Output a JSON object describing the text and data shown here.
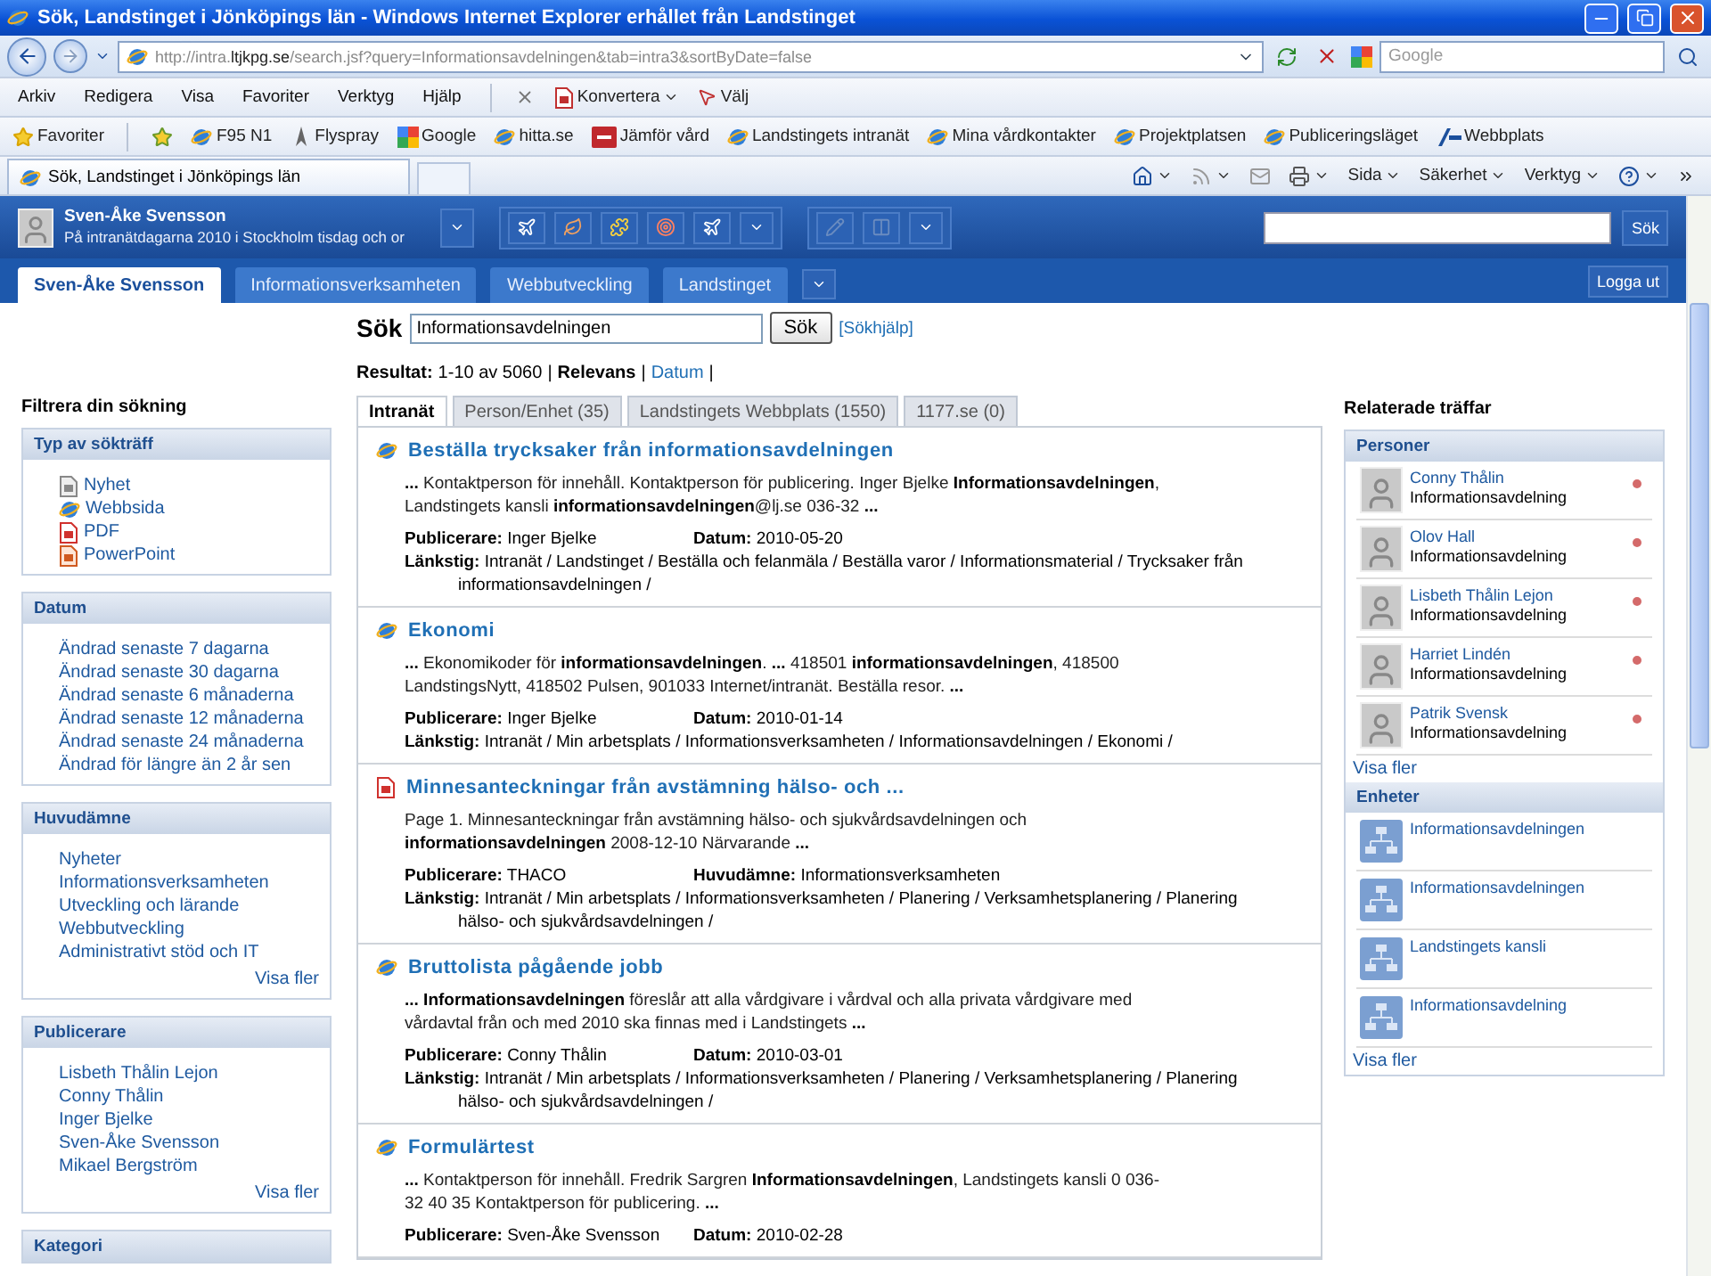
{
  "window": {
    "title": "Sök, Landstinget i Jönköpings län - Windows Internet Explorer erhållet från Landstinget"
  },
  "address_bar": {
    "url": "http://intra.**ltjkpg.se**/search.jsf?query=Informationsavdelningen&tab=intra3&sortByDate=false",
    "search_placeholder": "Google"
  },
  "menu": [
    "Arkiv",
    "Redigera",
    "Visa",
    "Favoriter",
    "Verktyg",
    "Hjälp"
  ],
  "toolbar_buttons": [
    {
      "label": "Konvertera",
      "kind": "convert"
    },
    {
      "label": "Välj",
      "kind": "select"
    }
  ],
  "favorites_bar": {
    "label": "Favoriter",
    "links": [
      {
        "label": "F95 N1",
        "kind": "ie"
      },
      {
        "label": "Flyspray",
        "kind": "flyspray"
      },
      {
        "label": "Google",
        "kind": "google"
      },
      {
        "label": "hitta.se",
        "kind": "ie"
      },
      {
        "label": "Jämför vård",
        "kind": "badge"
      },
      {
        "label": "Landstingets intranät",
        "kind": "ie"
      },
      {
        "label": "Mina vårdkontakter",
        "kind": "ie"
      },
      {
        "label": "Projektplatsen",
        "kind": "ie"
      },
      {
        "label": "Publiceringsläget",
        "kind": "ie"
      },
      {
        "label": "Webbplats",
        "kind": "logo"
      }
    ]
  },
  "browser_tab": {
    "title": "Sök, Landstinget i Jönköpings län"
  },
  "command_bar": [
    "Sida",
    "Säkerhet",
    "Verktyg"
  ],
  "user": {
    "name": "Sven-Åke Svensson",
    "status": "På intranätdagarna 2010 i Stockholm tisdag och or"
  },
  "header_search": {
    "button": "Sök"
  },
  "nav_tabs": [
    {
      "label": "Sven-Åke Svensson",
      "selected": true
    },
    {
      "label": "Informationsverksamheten",
      "selected": false
    },
    {
      "label": "Webbutveckling",
      "selected": false
    },
    {
      "label": "Landstinget",
      "selected": false
    }
  ],
  "logout": "Logga ut",
  "filters": {
    "title": "Filtrera din sökning",
    "groups": [
      {
        "title": "Typ av sökträff",
        "items": [
          {
            "label": "Nyhet",
            "kind": "news"
          },
          {
            "label": "Webbsida",
            "kind": "web"
          },
          {
            "label": "PDF",
            "kind": "pdf"
          },
          {
            "label": "PowerPoint",
            "kind": "ppt"
          }
        ]
      },
      {
        "title": "Datum",
        "items": [
          {
            "label": "Ändrad senaste 7 dagarna"
          },
          {
            "label": "Ändrad senaste 30 dagarna"
          },
          {
            "label": "Ändrad senaste 6 månaderna"
          },
          {
            "label": "Ändrad senaste 12 månaderna"
          },
          {
            "label": "Ändrad senaste 24 månaderna"
          },
          {
            "label": "Ändrad för längre än 2 år sen"
          }
        ]
      },
      {
        "title": "Huvudämne",
        "items": [
          {
            "label": "Nyheter"
          },
          {
            "label": "Informationsverksamheten"
          },
          {
            "label": "Utveckling och lärande"
          },
          {
            "label": "Webbutveckling"
          },
          {
            "label": "Administrativt stöd och IT"
          }
        ],
        "more": "Visa fler"
      },
      {
        "title": "Publicerare",
        "items": [
          {
            "label": "Lisbeth Thålin Lejon"
          },
          {
            "label": "Conny Thålin"
          },
          {
            "label": "Inger Bjelke"
          },
          {
            "label": "Sven-Åke Svensson"
          },
          {
            "label": "Mikael Bergström"
          }
        ],
        "more": "Visa fler"
      },
      {
        "title": "Kategori"
      }
    ]
  },
  "search": {
    "heading": "Sök",
    "value": "Informationsavdelningen",
    "button": "Sök",
    "help": "[Sökhjälp]"
  },
  "results_summary": {
    "label": "Resultat:",
    "range": "1-10 av 5060",
    "separator": "|",
    "sort_options": [
      {
        "label": "Relevans",
        "selected": true
      },
      {
        "label": "Datum",
        "selected": false
      }
    ]
  },
  "result_tabs": [
    {
      "label": "Intranät",
      "selected": true
    },
    {
      "label": "Person/Enhet (35)",
      "selected": false
    },
    {
      "label": "Landstingets Webbplats (1550)",
      "selected": false
    },
    {
      "label": "1177.se (0)",
      "selected": false
    }
  ],
  "results": [
    {
      "kind": "web",
      "title": "Beställa trycksaker från informationsavdelningen",
      "snippet": "**...** Kontaktperson för innehåll. Kontaktperson för publicering. Inger Bjelke **Informationsavdelningen**, Landstingets kansli **informationsavdelningen**@lj.se 036-32 **...**",
      "meta": [
        {
          "label": "Publicerare:",
          "value": "Inger Bjelke"
        },
        {
          "label": "Datum:",
          "value": "2010-05-20"
        }
      ],
      "path": {
        "label": "Länkstig:",
        "value": "Intranät / Landstinget / Beställa och felanmäla / Beställa varor / Informationsmaterial / Trycksaker från informationsavdelningen /"
      }
    },
    {
      "kind": "web",
      "title": "Ekonomi",
      "snippet": "**...** Ekonomikoder för **informationsavdelningen**. **...** 418501 **informationsavdelningen**, 418500 LandstingsNytt, 418502 Pulsen, 901033 Internet/intranät. Beställa resor. **...**",
      "meta": [
        {
          "label": "Publicerare:",
          "value": "Inger Bjelke"
        },
        {
          "label": "Datum:",
          "value": "2010-01-14"
        }
      ],
      "path": {
        "label": "Länkstig:",
        "value": "Intranät / Min arbetsplats / Informationsverksamheten / Informationsavdelningen / Ekonomi /"
      }
    },
    {
      "kind": "pdf",
      "title": "Minnesanteckningar från avstämning hälso- och ...",
      "snippet": "Page 1. Minnesanteckningar från avstämning hälso- och sjukvårdsavdelningen och **informationsavdelningen** 2008-12-10 Närvarande **...**",
      "meta": [
        {
          "label": "Publicerare:",
          "value": "THACO"
        },
        {
          "label": "Huvudämne:",
          "value": "Informationsverksamheten"
        }
      ],
      "path": {
        "label": "Länkstig:",
        "value": "Intranät / Min arbetsplats / Informationsverksamheten / Planering / Verksamhetsplanering / Planering hälso- och sjukvårdsavdelningen /"
      }
    },
    {
      "kind": "web",
      "title": "Bruttolista pågående jobb",
      "snippet": "**... Informationsavdelningen** föreslår att alla vårdgivare i vårdval och alla privata vårdgivare med vårdavtal från och med 2010 ska finnas med i Landstingets **...**",
      "meta": [
        {
          "label": "Publicerare:",
          "value": "Conny Thålin"
        },
        {
          "label": "Datum:",
          "value": "2010-03-01"
        }
      ],
      "path": {
        "label": "Länkstig:",
        "value": "Intranät / Min arbetsplats / Informationsverksamheten / Planering / Verksamhetsplanering / Planering hälso- och sjukvårdsavdelningen /"
      }
    },
    {
      "kind": "web",
      "title": "Formulärtest",
      "snippet": "**...** Kontaktperson för innehåll. Fredrik Sargren **Informationsavdelningen**, Landstingets kansli 0 036-32 40 35 Kontaktperson för publicering. **...**",
      "meta": [
        {
          "label": "Publicerare:",
          "value": "Sven-Åke Svensson"
        },
        {
          "label": "Datum:",
          "value": "2010-02-28"
        }
      ]
    }
  ],
  "related": {
    "title": "Relaterade träffar",
    "persons": {
      "title": "Personer",
      "more": "Visa fler",
      "items": [
        {
          "name": "Conny Thålin",
          "unit": "Informationsavdelning",
          "color": "#d46a6a"
        },
        {
          "name": "Olov Hall",
          "unit": "Informationsavdelning",
          "color": "#d46a6a"
        },
        {
          "name": "Lisbeth Thålin Lejon",
          "unit": "Informationsavdelning",
          "color": "#d46a6a"
        },
        {
          "name": "Harriet Lindén",
          "unit": "Informationsavdelning",
          "color": "#d46a6a"
        },
        {
          "name": "Patrik Svensk",
          "unit": "Informationsavdelning",
          "color": "#d46a6a"
        }
      ]
    },
    "units": {
      "title": "Enheter",
      "more": "Visa fler",
      "items": [
        "Informationsavdelningen",
        "Informationsavdelningen",
        "Landstingets kansli",
        "Informationsavdelning"
      ]
    }
  }
}
